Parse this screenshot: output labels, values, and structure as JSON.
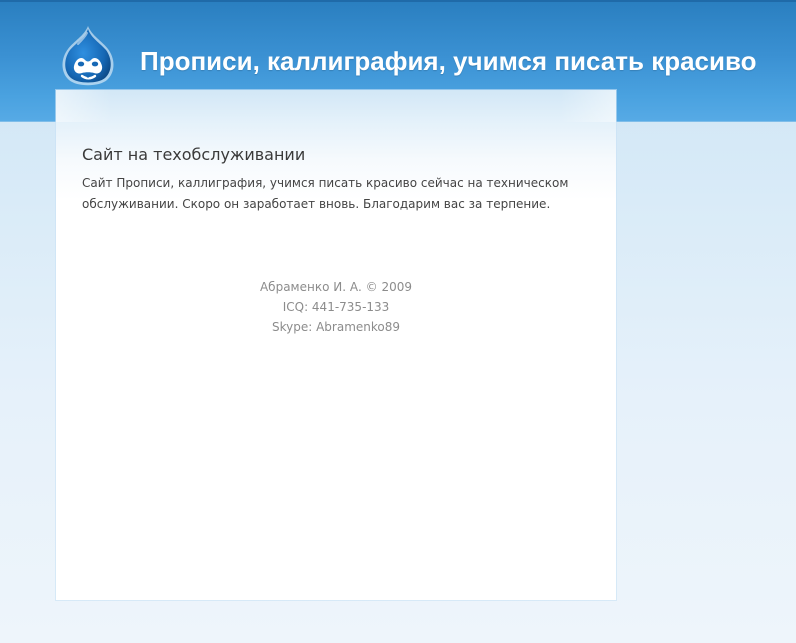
{
  "header": {
    "title": "Прописи, каллиграфия, учимся писать красиво",
    "logo_icon": "drupal-drop-icon",
    "colors": {
      "header_blue": "#3b91d3",
      "logo_blue": "#1668b5"
    }
  },
  "main": {
    "title": "Сайт на техобслуживании",
    "message": "Сайт Прописи, каллиграфия, учимся писать красиво сейчас на техническом обслуживании. Скоро он заработает вновь. Благодарим вас за терпение."
  },
  "footer": {
    "copyright": "Абраменко И. А. © 2009",
    "icq": "ICQ: 441-735-133",
    "skype": "Skype: Abramenko89"
  }
}
